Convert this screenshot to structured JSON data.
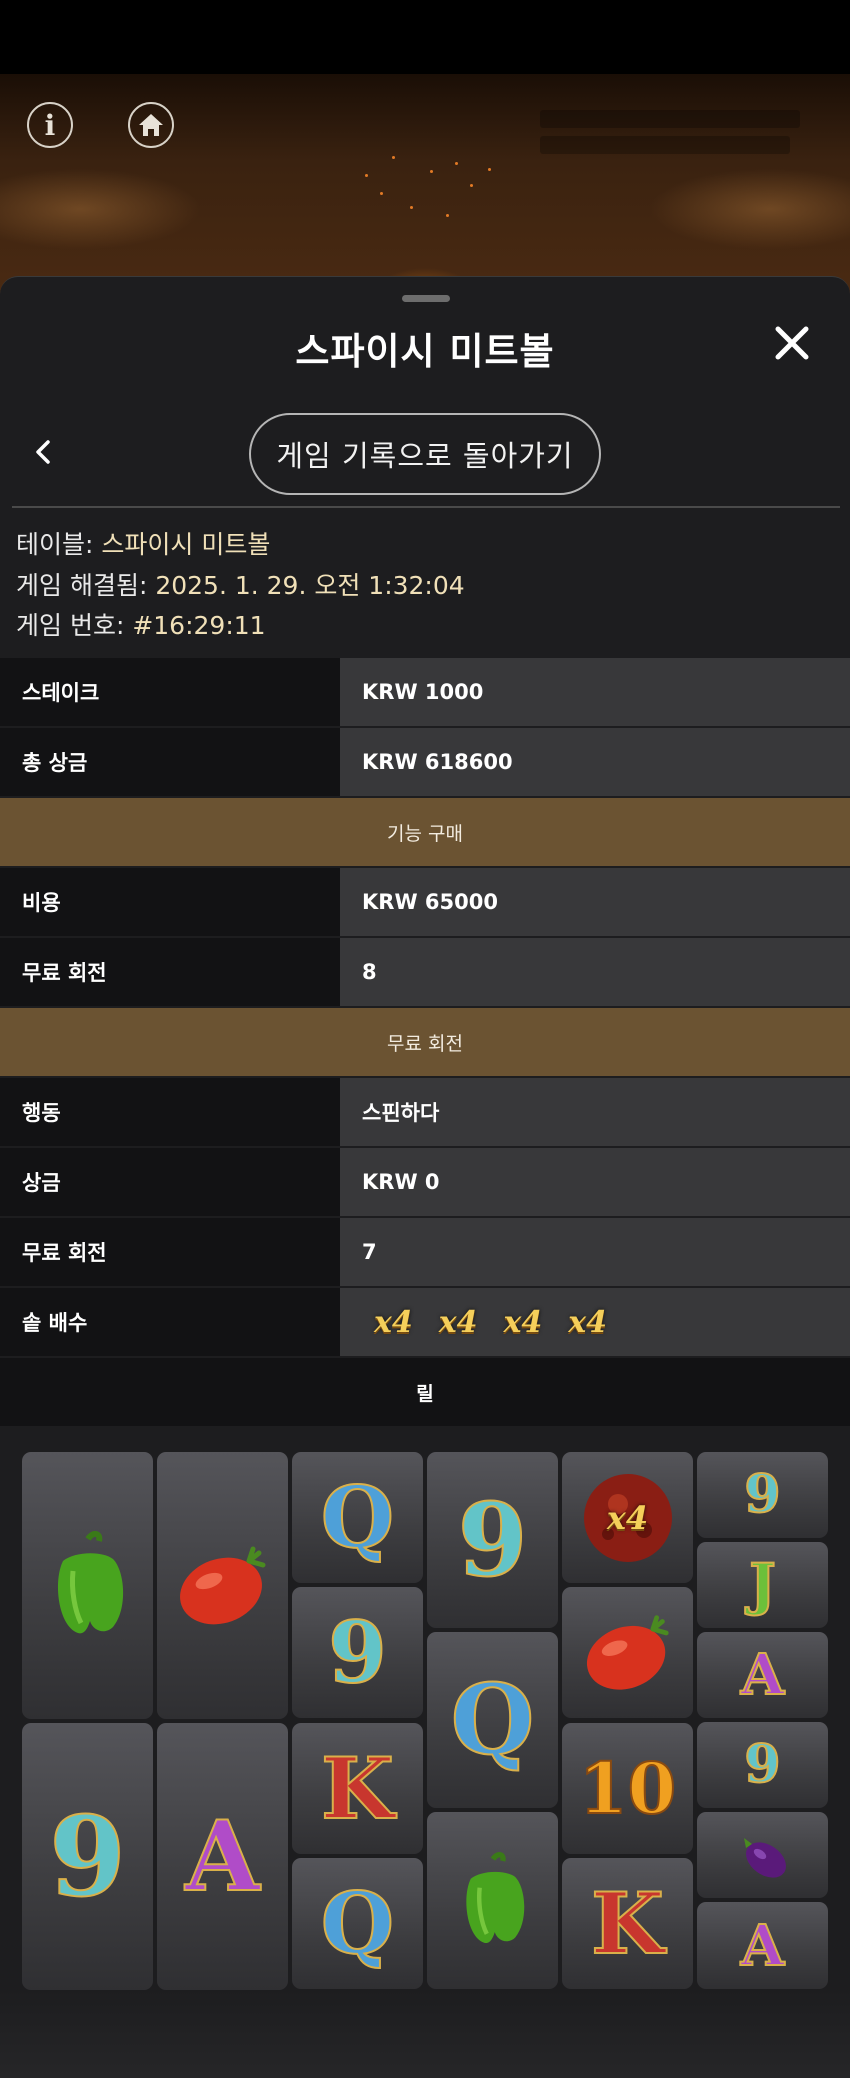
{
  "panel": {
    "title": "스파이시 미트볼",
    "history_button": "게임 기록으로 돌아가기"
  },
  "meta": {
    "table_label": "테이블:",
    "table_value": "스파이시 미트볼",
    "resolved_label": "게임 해결됨:",
    "resolved_value": "2025. 1. 29. 오전 1:32:04",
    "number_label": "게임 번호:",
    "number_value": "#16:29:11"
  },
  "summary": [
    {
      "label": "스테이크",
      "value": "KRW 1000"
    },
    {
      "label": "총 상금",
      "value": "KRW 618600"
    }
  ],
  "feature_buy": {
    "header": "기능 구매",
    "rows": [
      {
        "label": "비용",
        "value": "KRW 65000"
      },
      {
        "label": "무료 회전",
        "value": "8"
      }
    ]
  },
  "free_spins": {
    "header": "무료 회전",
    "rows": [
      {
        "label": "행동",
        "value": "스핀하다"
      },
      {
        "label": "상금",
        "value": "KRW 0"
      },
      {
        "label": "무료 회전",
        "value": "7"
      }
    ],
    "pot_multiplier_label": "솥 배수",
    "pot_multipliers": [
      "x4",
      "x4",
      "x4",
      "x4"
    ]
  },
  "reels": {
    "header": "릴",
    "symbols": {
      "col1": [
        "pepper",
        "9"
      ],
      "col2": [
        "tomato",
        "A"
      ],
      "col3": [
        "Q",
        "9",
        "K",
        "Q"
      ],
      "col4": [
        "9",
        "Q",
        "pepper"
      ],
      "col5": [
        "meatball-x4",
        "tomato",
        "10",
        "K"
      ],
      "col6": [
        "9",
        "J",
        "A",
        "9",
        "eggplant",
        "A"
      ]
    },
    "meatball_multiplier": "x4"
  },
  "colors": {
    "panel_bg": "#1d1d1f",
    "label_bg": "#121214",
    "value_bg": "#38383a",
    "section_bg": "#6b5332",
    "multiplier_gold": "#f5cf5a"
  }
}
